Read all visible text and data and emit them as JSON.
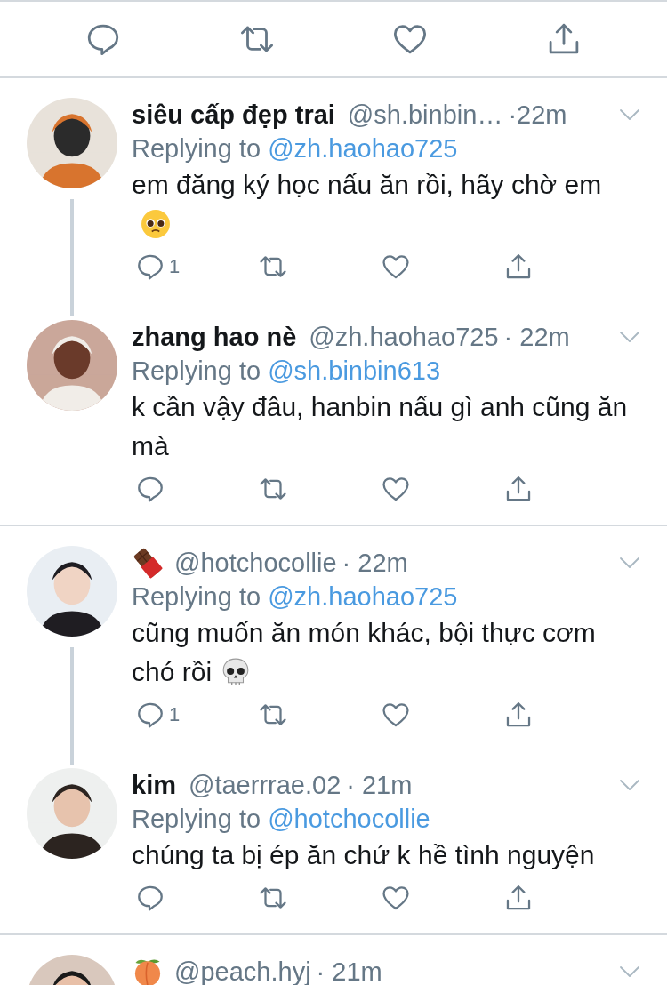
{
  "groups": [
    {
      "tweets": [
        {
          "name": "siêu cấp đẹp trai",
          "handle": "@sh.binbin…",
          "time": "·22m",
          "replying_prefix": "Replying to",
          "reply_to": "@zh.haohao725",
          "text": "em đăng ký học nấu ăn rồi, hãy chờ em",
          "text_icon": {
            "kind": "pleading"
          },
          "reply_count": "1",
          "thread_line": true
        },
        {
          "name": "zhang hao nè",
          "handle": "@zh.haohao725",
          "time": "· 22m",
          "replying_prefix": "Replying to",
          "reply_to": "@sh.binbin613",
          "text": "k cần vậy đâu, hanbin nấu gì anh cũng ăn mà",
          "thread_line": false
        }
      ]
    },
    {
      "tweets": [
        {
          "name_icon": {
            "kind": "chocolate"
          },
          "handle": "@hotchocollie",
          "time": "· 22m",
          "replying_prefix": "Replying to",
          "reply_to": "@zh.haohao725",
          "text": "cũng muốn ăn món khác, bội thực cơm chó rồi",
          "text_icon": {
            "kind": "skull"
          },
          "reply_count": "1",
          "thread_line": true
        },
        {
          "name": "kim",
          "handle": "@taerrrae.02",
          "time": "· 21m",
          "replying_prefix": "Replying to",
          "reply_to": "@hotchocollie",
          "text": "chúng ta bị ép ăn chứ k hề tình nguyện",
          "thread_line": false
        }
      ]
    },
    {
      "tweets": [
        {
          "name_icon": {
            "kind": "peach"
          },
          "handle": "@peach.hyj",
          "time": "· 21m",
          "thread_line": false
        }
      ]
    }
  ]
}
